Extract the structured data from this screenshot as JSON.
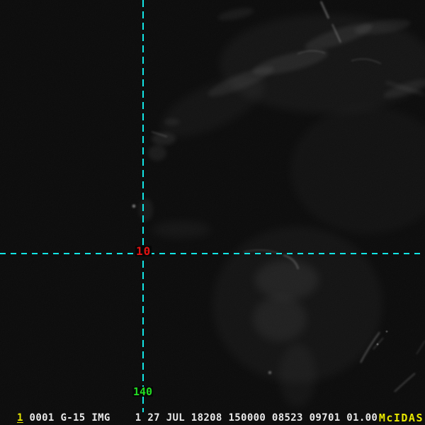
{
  "display": {
    "description": "GOES-15 visible satellite image frame",
    "background_color": "#060606"
  },
  "crosshair": {
    "line_color": "#12e6e6",
    "latitude_value": "10",
    "latitude_color": "#e01212",
    "longitude_value": "140",
    "longitude_color": "#22dd22"
  },
  "status_bar": {
    "frame_number": "1",
    "frame_color": "#e8e800",
    "info_text": " 0001 G-15 IMG    1 27 JUL 18208 150000 08523 09701 01.00",
    "info_color": "#e8e8e8",
    "brand": "McIDAS",
    "brand_color": "#e8e800"
  }
}
